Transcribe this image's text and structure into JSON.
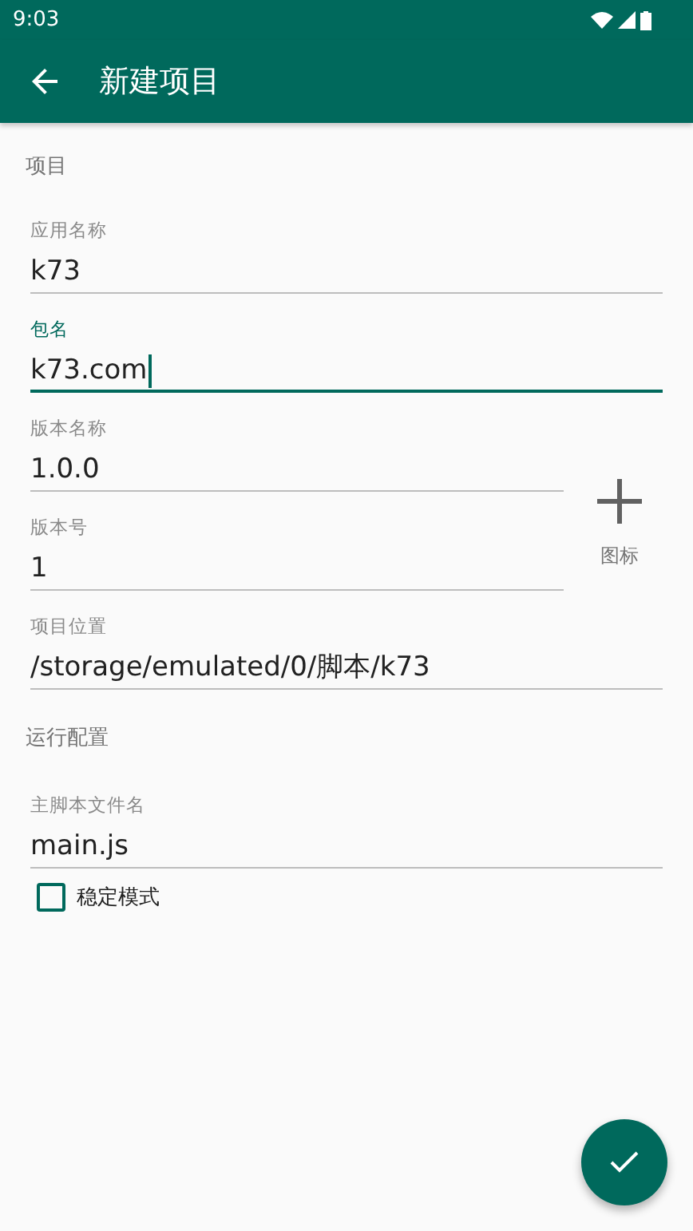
{
  "status_bar": {
    "time": "9:03"
  },
  "toolbar": {
    "title": "新建项目"
  },
  "sections": [
    {
      "title": "项目",
      "items": [
        {
          "kind": "field",
          "label": "应用名称",
          "value": "k73",
          "focused": false
        },
        {
          "kind": "field",
          "label": "包名",
          "value": "k73.com",
          "focused": true
        },
        {
          "kind": "group",
          "fields": [
            {
              "label": "版本名称",
              "value": "1.0.0",
              "focused": false
            },
            {
              "label": "版本号",
              "value": "1",
              "focused": false
            }
          ],
          "icon_picker": {
            "label": "图标"
          }
        },
        {
          "kind": "field",
          "label": "项目位置",
          "value": "/storage/emulated/0/脚本/k73",
          "focused": false
        }
      ]
    },
    {
      "title": "运行配置",
      "items": [
        {
          "kind": "field",
          "label": "主脚本文件名",
          "value": "main.js",
          "focused": false
        },
        {
          "kind": "checkbox",
          "label": "稳定模式",
          "checked": false
        }
      ]
    }
  ]
}
